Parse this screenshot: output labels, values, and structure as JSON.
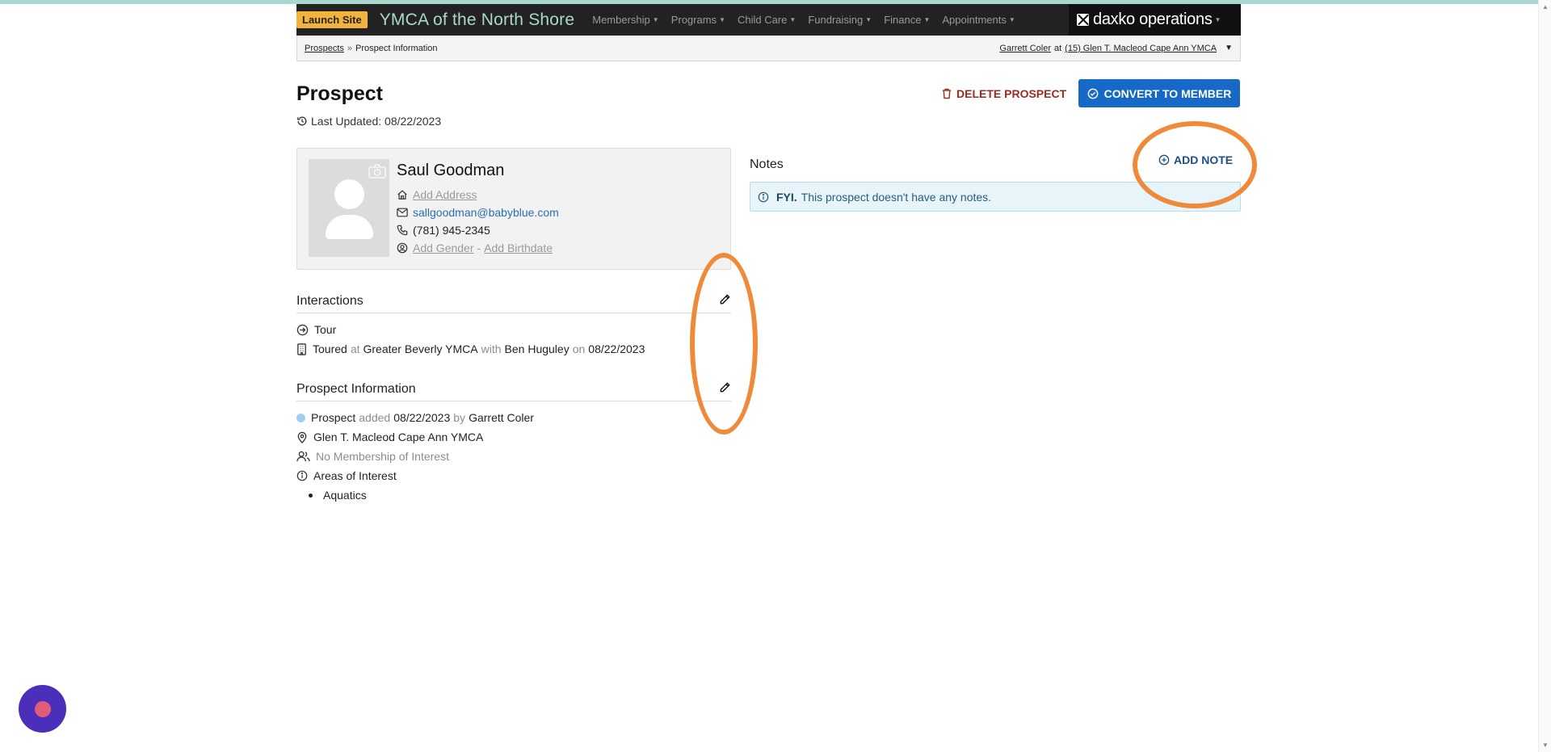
{
  "header": {
    "launch_label": "Launch Site",
    "org_name": "YMCA of the North Shore",
    "nav": [
      "Membership",
      "Programs",
      "Child Care",
      "Fundraising",
      "Finance",
      "Appointments"
    ],
    "brand": "daxko operations"
  },
  "breadcrumb": {
    "root": "Prospects",
    "separator": "»",
    "current": "Prospect Information",
    "user": "Garrett Coler",
    "at": "at",
    "location": "(15) Glen T. Macleod Cape Ann YMCA"
  },
  "page": {
    "title": "Prospect",
    "last_updated": "Last Updated: 08/22/2023",
    "delete_label": "DELETE PROSPECT",
    "convert_label": "CONVERT TO MEMBER"
  },
  "profile": {
    "name": "Saul Goodman",
    "add_address": "Add Address",
    "email": "sallgoodman@babyblue.com",
    "phone": "(781) 945-2345",
    "add_gender": "Add Gender",
    "dash": "-",
    "add_birthdate": "Add Birthdate"
  },
  "interactions": {
    "title": "Interactions",
    "type": "Tour",
    "toured": "Toured",
    "at": "at",
    "location": "Greater Beverly YMCA",
    "with": "with",
    "staff": "Ben Huguley",
    "on": "on",
    "date": "08/22/2023"
  },
  "prospect_info": {
    "title": "Prospect Information",
    "status": "Prospect",
    "added": "added",
    "date": "08/22/2023",
    "by": "by",
    "author": "Garrett Coler",
    "branch": "Glen T. Macleod Cape Ann YMCA",
    "membership": "No Membership of Interest",
    "areas_title": "Areas of Interest",
    "areas": [
      "Aquatics"
    ]
  },
  "notes": {
    "title": "Notes",
    "add_label": "ADD NOTE",
    "fyi_strong": "FYI.",
    "fyi_text": "This prospect doesn't have any notes."
  },
  "colors": {
    "accent_blue": "#1769c7",
    "danger": "#9b2b1f",
    "annotation_orange": "#ef8a3a",
    "launch_yellow": "#f2b33d"
  }
}
